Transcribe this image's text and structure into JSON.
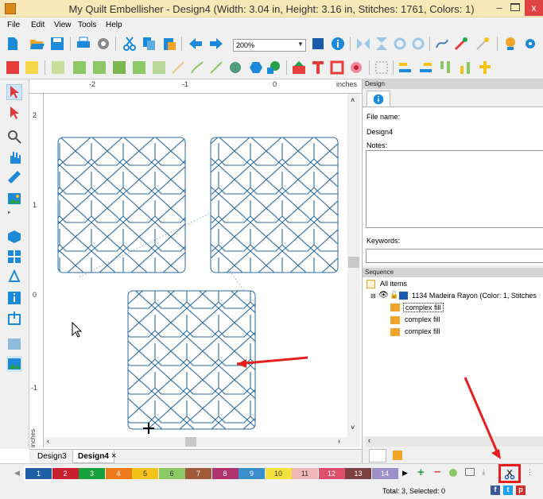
{
  "window": {
    "title": "My Quilt Embellisher - Design4 (Width: 3.04 in, Height: 3.16 in, Stitches: 1761, Colors: 1)",
    "min": "–",
    "close": "x"
  },
  "menu": [
    "File",
    "Edit",
    "View",
    "Tools",
    "Help"
  ],
  "toolbar": {
    "zoom": "200%"
  },
  "ruler": {
    "unit": "inches",
    "top_labels": [
      "-2",
      "-1",
      "0"
    ],
    "left_labels": [
      "2",
      "1",
      "0",
      "-1"
    ],
    "left_unit": "inches"
  },
  "doc_tabs": [
    {
      "label": "Design3"
    },
    {
      "label": "Design4"
    }
  ],
  "tab_close": "×",
  "design_panel": {
    "header": "Design",
    "filename_label": "File name:",
    "filename_value": "Design4",
    "notes_label": "Notes:",
    "keywords_label": "Keywords:"
  },
  "sequence": {
    "header": "Sequence",
    "all_items": "All items",
    "thread": "1134 Madeira Rayon (Color: 1, Stitches",
    "objects": [
      "complex fill",
      "complex fill",
      "complex fill"
    ]
  },
  "color_swatches": [
    {
      "label": "1",
      "color": "#1f5fa8"
    },
    {
      "label": "2",
      "color": "#c8202f"
    },
    {
      "label": "3",
      "color": "#17a03a"
    },
    {
      "label": "4",
      "color": "#ef7a1a"
    },
    {
      "label": "5",
      "color": "#f5c21a"
    },
    {
      "label": "6",
      "color": "#8cc865"
    },
    {
      "label": "7",
      "color": "#a05a38"
    },
    {
      "label": "8",
      "color": "#b0336e"
    },
    {
      "label": "9",
      "color": "#3a8fcf"
    },
    {
      "label": "10",
      "color": "#f2e040"
    },
    {
      "label": "11",
      "color": "#f1b6b6"
    },
    {
      "label": "12",
      "color": "#de4f6a"
    },
    {
      "label": "13",
      "color": "#7e3f3f"
    },
    {
      "label": "14",
      "color": "#9c8fc8"
    }
  ],
  "status": "Total: 3, Selected: 0",
  "social": [
    "f",
    "t",
    "p"
  ]
}
